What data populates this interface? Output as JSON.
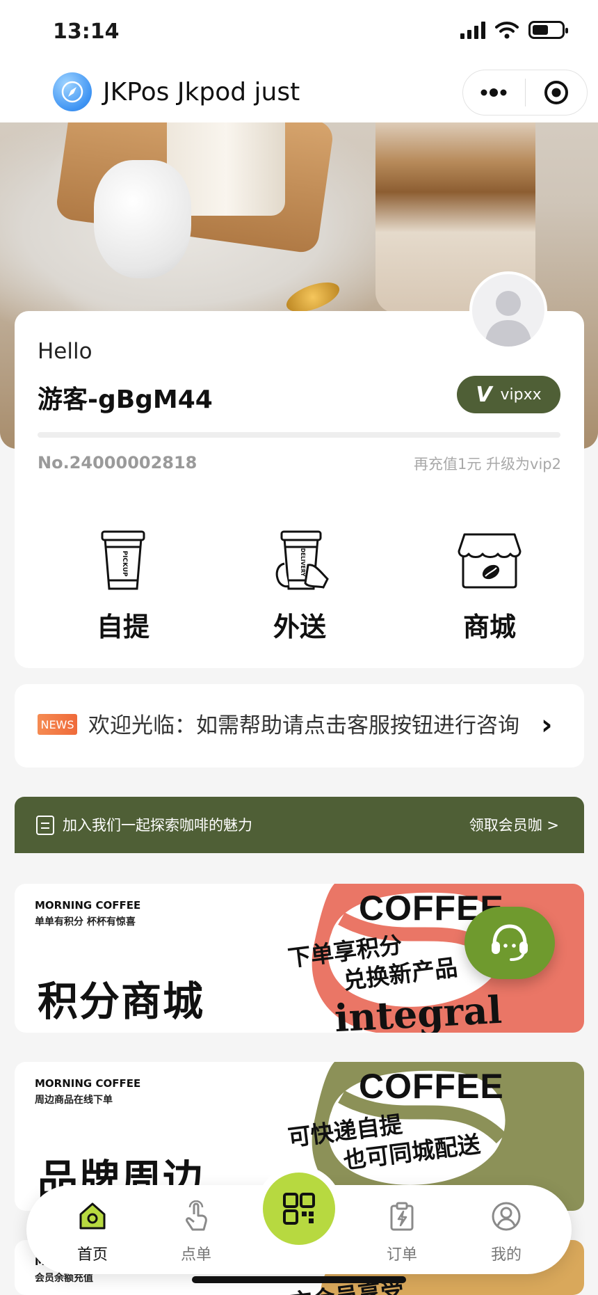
{
  "status_bar": {
    "time": "13:14"
  },
  "title_bar": {
    "app_name": "JKPos Jkpod just"
  },
  "member": {
    "greeting": "Hello",
    "username": "游客-gBgM44",
    "vip_level": "vipxx",
    "member_no": "No.24000002818",
    "upgrade_hint": "再充值1元 升级为vip2",
    "progress_fraction": 0
  },
  "services": [
    {
      "label": "自提",
      "icon": "pickup-cup-icon",
      "cup_text": "PICKUP"
    },
    {
      "label": "外送",
      "icon": "delivery-cup-icon",
      "cup_text": "DELIVERY"
    },
    {
      "label": "商城",
      "icon": "store-icon"
    }
  ],
  "notice": {
    "tag": "NEWS",
    "text": "欢迎光临：如需帮助请点击客服按钮进行咨询"
  },
  "join_banner": {
    "text": "加入我们一起探索咖啡的魅力",
    "link": "领取会员咖 >"
  },
  "promos": [
    {
      "kicker": "MORNING COFFEE",
      "sub": "单单有积分 杯杯有惊喜",
      "title": "积分商城",
      "art_word": "COFFEE",
      "slogan_line1": "下单享积分",
      "slogan_line2": "兑换新产品",
      "script_word": "integral",
      "color": "#ea7666"
    },
    {
      "kicker": "MORNING COFFEE",
      "sub": "周边商品在线下单",
      "title": "品牌周边",
      "art_word": "COFFEE",
      "slogan_line1": "可快递自提",
      "slogan_line2": "也可同城配送",
      "color": "#8c9158"
    },
    {
      "kicker": "M",
      "sub": "会员余额充值",
      "slogan_line1": "充会员享受",
      "color": "#d9a85b"
    }
  ],
  "tab_bar": {
    "items": [
      {
        "label": "首页",
        "icon": "home-icon",
        "active": true
      },
      {
        "label": "点单",
        "icon": "tap-hand-icon"
      },
      {
        "label": "订单",
        "icon": "order-clipboard-icon"
      },
      {
        "label": "我的",
        "icon": "profile-icon"
      }
    ],
    "center_icon": "qr-scan-icon"
  },
  "colors": {
    "accent_green": "#4f5f36",
    "cs_button": "#6f9a2e",
    "scan_button": "#b7d940",
    "news_tag": "#ef6a3a"
  }
}
